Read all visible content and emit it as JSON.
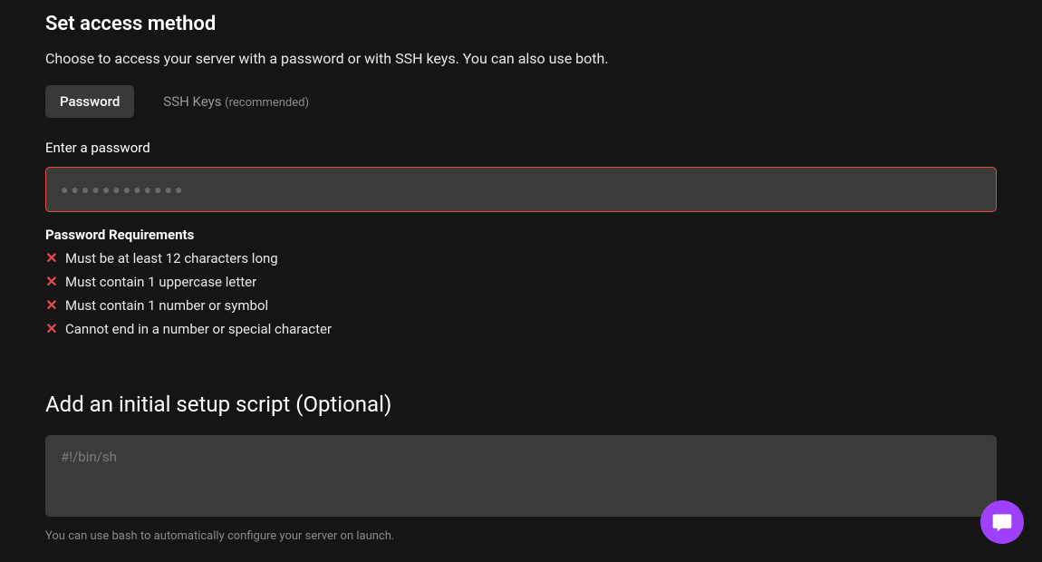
{
  "access": {
    "title": "Set access method",
    "description": "Choose to access your server with a password or with SSH keys. You can also use both.",
    "tabs": {
      "password": "Password",
      "sshkeys": "SSH Keys",
      "recommended": "(recommended)"
    },
    "password_label": "Enter a password",
    "password_placeholder": "●●●●●●●●●●●●"
  },
  "requirements": {
    "title": "Password Requirements",
    "items": [
      "Must be at least 12 characters long",
      "Must contain 1 uppercase letter",
      "Must contain 1 number or symbol",
      "Cannot end in a number or special character"
    ]
  },
  "setup": {
    "title": "Add an initial setup script (Optional)",
    "placeholder": "#!/bin/sh",
    "description": "You can use bash to automatically configure your server on launch."
  },
  "colors": {
    "background": "#151515",
    "input_bg": "#3a3c3a",
    "error": "#e84a4a",
    "tab_active": "#393939",
    "chat": "#a040ff"
  }
}
